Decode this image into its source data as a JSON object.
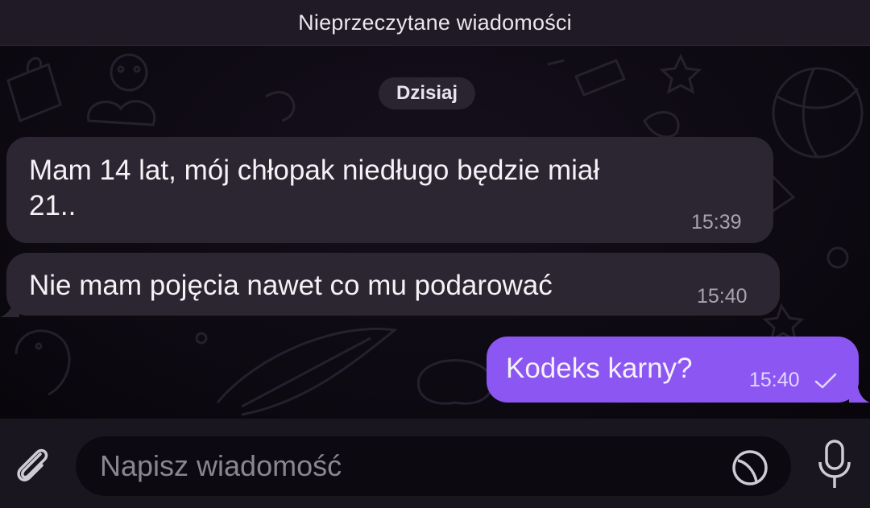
{
  "header": {
    "unread_label": "Nieprzeczytane wiadomości"
  },
  "chat": {
    "date_label": "Dzisiaj",
    "messages": [
      {
        "direction": "incoming",
        "line1": "Mam 14 lat, mój chłopak niedługo będzie miał",
        "line2": "21..",
        "time": "15:39"
      },
      {
        "direction": "incoming",
        "line1": "Nie mam pojęcia nawet co mu podarować",
        "time": "15:40"
      },
      {
        "direction": "outgoing",
        "line1": "Kodeks karny?",
        "time": "15:40",
        "status": "sent-check"
      }
    ]
  },
  "composer": {
    "placeholder": "Napisz wiadomość",
    "icons": [
      "paperclip-icon",
      "sticker-icon",
      "microphone-icon"
    ]
  },
  "colors": {
    "outgoing_bubble": "#8c56f3",
    "incoming_bubble": "#2b2631",
    "background": "#0b0810"
  }
}
